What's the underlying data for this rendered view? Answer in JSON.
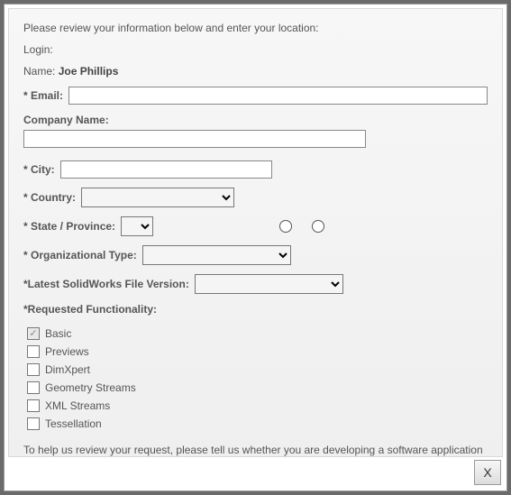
{
  "intro": "Please review your information below and enter your location:",
  "login_label": "Login:",
  "name_label": "Name:",
  "name_value": "Joe Phillips",
  "email_label": "* Email:",
  "company_label": "Company Name:",
  "city_label": "* City:",
  "country_label": "* Country:",
  "state_label": "* State / Province:",
  "orgtype_label": "* Organizational Type:",
  "filever_label": "*Latest SolidWorks File Version:",
  "func_label": "*Requested Functionality:",
  "func_items": [
    {
      "label": "Basic",
      "checked": true,
      "disabled": true
    },
    {
      "label": "Previews",
      "checked": false,
      "disabled": false
    },
    {
      "label": "DimXpert",
      "checked": false,
      "disabled": false
    },
    {
      "label": "Geometry Streams",
      "checked": false,
      "disabled": false
    },
    {
      "label": "XML Streams",
      "checked": false,
      "disabled": false
    },
    {
      "label": "Tessellation",
      "checked": false,
      "disabled": false
    }
  ],
  "footer_text": "To help us review your request, please tell us whether you are developing a software application for:",
  "close_label": "X"
}
